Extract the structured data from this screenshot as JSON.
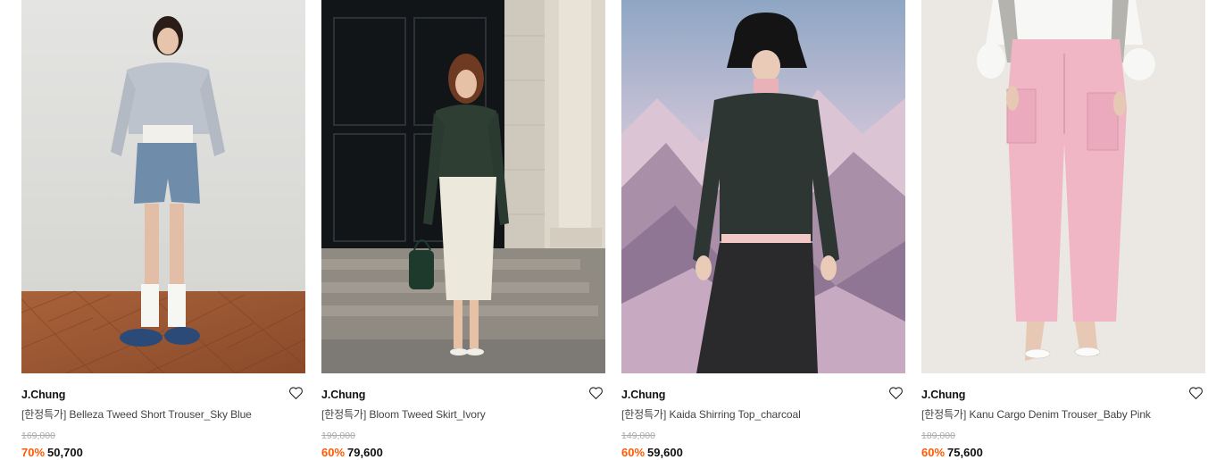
{
  "colors": {
    "discount": "#ff5a00",
    "text": "#111111",
    "muted": "#aaaaaa"
  },
  "products": [
    {
      "brand": "J.Chung",
      "name": "[한정특가] Belleza Tweed Short Trouser_Sky Blue",
      "original_price": "169,000",
      "discount": "70%",
      "sale_price": "50,700",
      "image_alt": "Model in grey cardigan and sky blue tweed shorts",
      "icon": "heart-icon"
    },
    {
      "brand": "J.Chung",
      "name": "[한정특가] Bloom Tweed Skirt_Ivory",
      "original_price": "199,000",
      "discount": "60%",
      "sale_price": "79,600",
      "image_alt": "Model in green cardigan and ivory tweed skirt",
      "icon": "heart-icon"
    },
    {
      "brand": "J.Chung",
      "name": "[한정특가] Kaida Shirring Top_charcoal",
      "original_price": "149,000",
      "discount": "60%",
      "sale_price": "59,600",
      "image_alt": "Model in black bucket hat and charcoal shirring top",
      "icon": "heart-icon"
    },
    {
      "brand": "J.Chung",
      "name": "[한정특가] Kanu Cargo Denim Trouser_Baby Pink",
      "original_price": "189,000",
      "discount": "60%",
      "sale_price": "75,600",
      "image_alt": "Model wearing baby pink cargo denim trousers",
      "icon": "heart-icon"
    }
  ]
}
